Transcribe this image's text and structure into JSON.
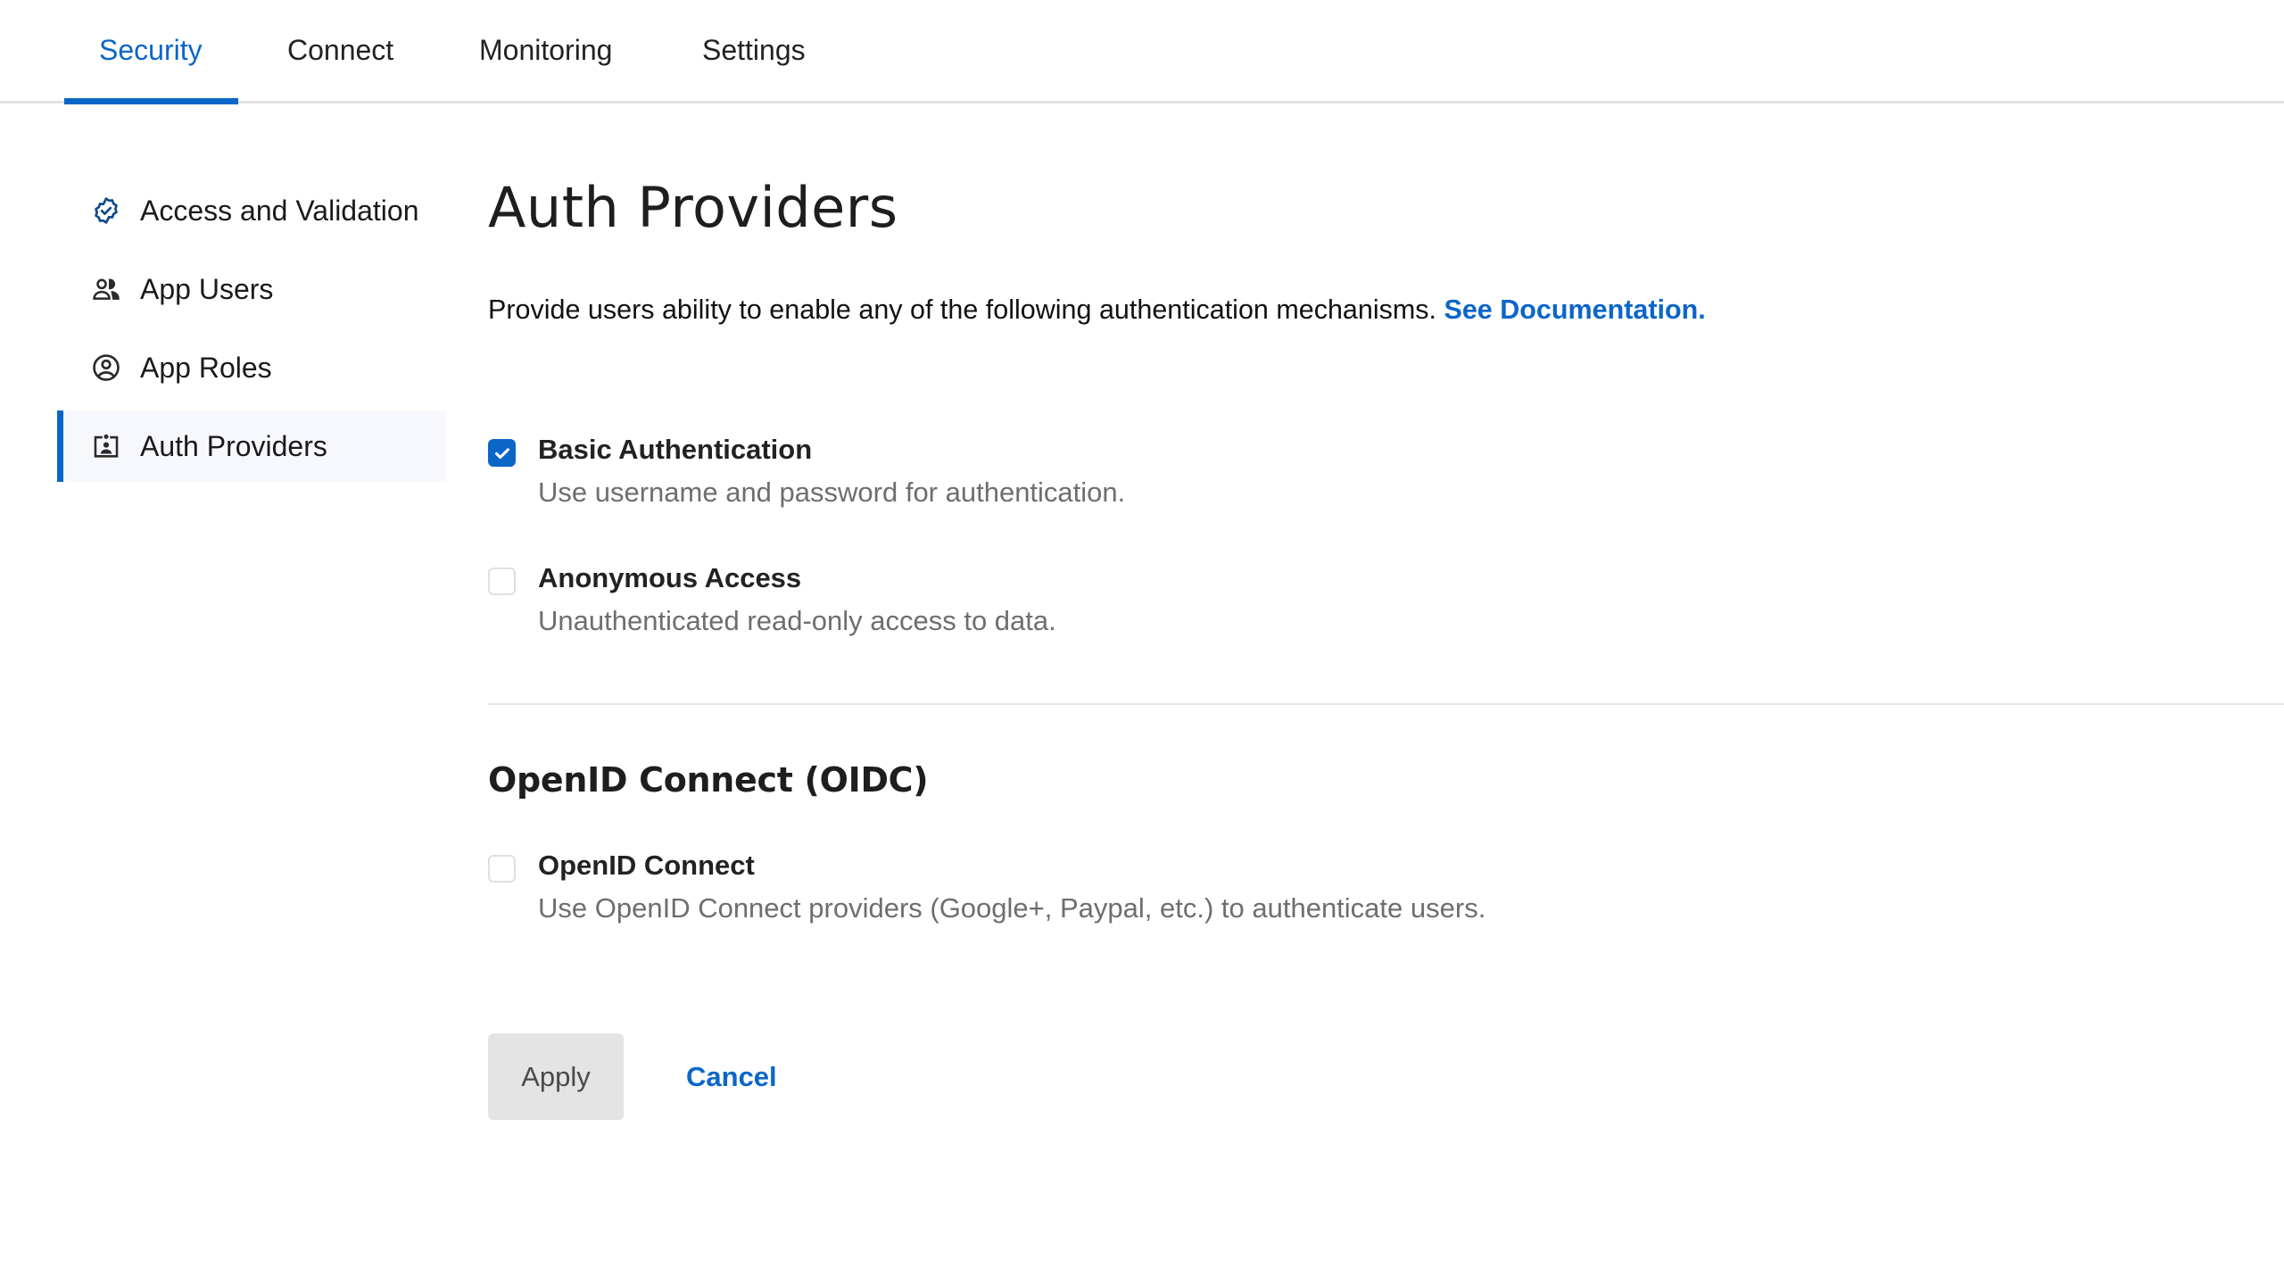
{
  "tabs": [
    {
      "label": "Security",
      "active": true
    },
    {
      "label": "Connect",
      "active": false
    },
    {
      "label": "Monitoring",
      "active": false
    },
    {
      "label": "Settings",
      "active": false
    }
  ],
  "sidebar": {
    "items": [
      {
        "label": "Access and Validation",
        "icon": "verified-badge-icon",
        "active": false
      },
      {
        "label": "App Users",
        "icon": "users-icon",
        "active": false
      },
      {
        "label": "App Roles",
        "icon": "account-circle-icon",
        "active": false
      },
      {
        "label": "Auth Providers",
        "icon": "id-badge-icon",
        "active": true
      }
    ]
  },
  "main": {
    "title": "Auth Providers",
    "intro_text": "Provide users ability to enable any of the following authentication mechanisms. ",
    "doc_link": "See Documentation.",
    "options": [
      {
        "label": "Basic Authentication",
        "description": "Use username and password for authentication.",
        "checked": true
      },
      {
        "label": "Anonymous Access",
        "description": "Unauthenticated read-only access to data.",
        "checked": false
      }
    ],
    "oidc_section": {
      "title": "OpenID Connect (OIDC)",
      "options": [
        {
          "label": "OpenID Connect",
          "description": "Use OpenID Connect providers (Google+, Paypal, etc.) to authenticate users.",
          "checked": false
        }
      ]
    },
    "actions": {
      "apply_label": "Apply",
      "cancel_label": "Cancel"
    }
  },
  "colors": {
    "accent": "#0b66c8",
    "active_bg": "#f7f8fd",
    "muted_text": "#6e6e6e",
    "border": "#e3e3e3",
    "apply_bg": "#e4e4e4"
  }
}
